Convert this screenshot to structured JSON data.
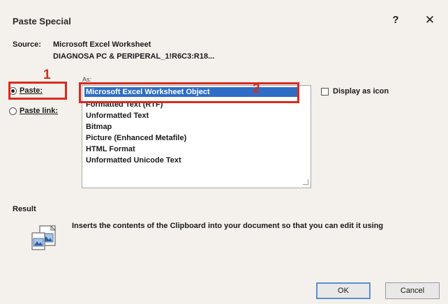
{
  "dialog": {
    "title": "Paste Special",
    "help_glyph": "?",
    "close_glyph": "✕"
  },
  "source": {
    "label": "Source:",
    "line1": "Microsoft Excel Worksheet",
    "line2": "DIAGNOSA PC & PERIPERAL_1!R6C3:R18..."
  },
  "as_label": "As:",
  "options": {
    "paste_label": "Paste:",
    "paste_link_label": "Paste link:"
  },
  "callouts": {
    "num1": "1",
    "num2": "2"
  },
  "list": {
    "items": [
      "Microsoft Excel Worksheet Object",
      "Formatted Text (RTF)",
      "Unformatted Text",
      "Bitmap",
      "Picture (Enhanced Metafile)",
      "HTML Format",
      "Unformatted Unicode Text"
    ],
    "selected_index": 0
  },
  "display_as_icon_label": "Display as icon",
  "result": {
    "label": "Result",
    "text": "Inserts the contents of the Clipboard into your document so that you can edit it using"
  },
  "buttons": {
    "ok": "OK",
    "cancel": "Cancel"
  },
  "colors": {
    "selection": "#2e6dc6",
    "callout": "#d92b1e"
  }
}
